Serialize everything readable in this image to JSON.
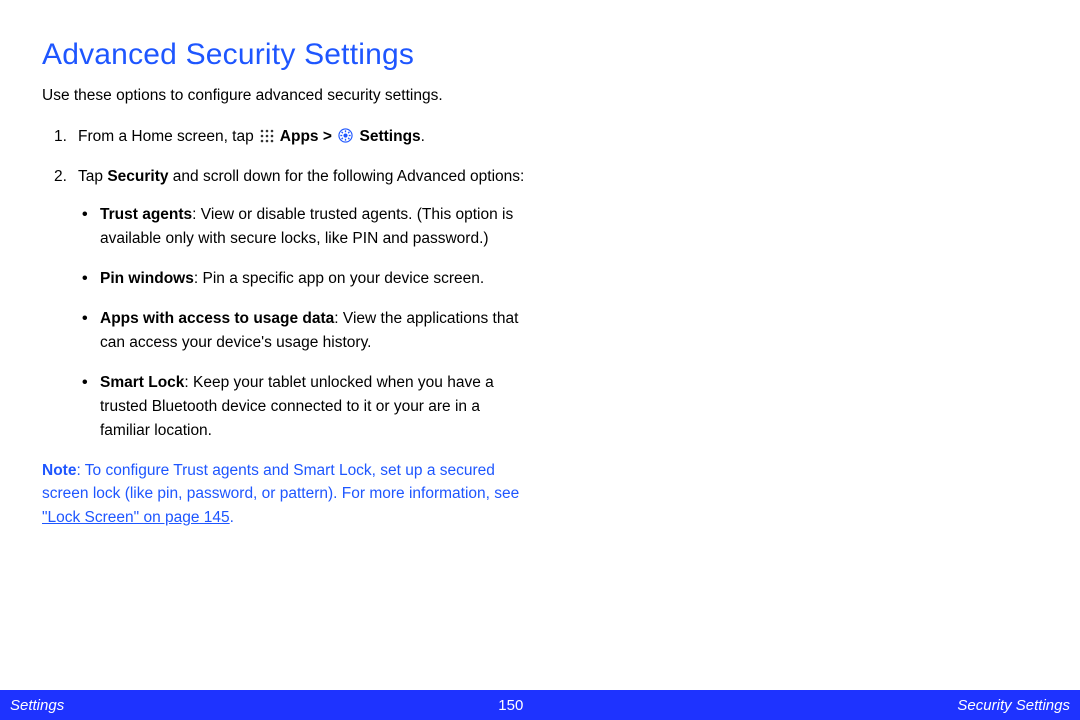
{
  "title": "Advanced Security Settings",
  "intro": "Use these options to configure advanced security settings.",
  "step1": {
    "num": "1.",
    "pre": "From a Home screen, tap ",
    "apps": " Apps > ",
    "settings": " Settings",
    "tail": "."
  },
  "step2": {
    "num": "2.",
    "lead_a": "Tap ",
    "lead_bold": "Security",
    "lead_b": " and scroll down for the following Advanced options:"
  },
  "bullets": {
    "b1_t": "Trust agents",
    "b1_r": ": View or disable trusted agents. (This option is available only with secure locks, like PIN and password.)",
    "b2_t": "Pin windows",
    "b2_r": ": Pin a specific app on your device screen.",
    "b3_t": "Apps with access to usage data",
    "b3_r": ": View the applications that can access your device's usage history.",
    "b4_t": "Smart Lock",
    "b4_r": ": Keep your tablet unlocked when you have a trusted Bluetooth device connected to it or your are in a familiar location."
  },
  "note": {
    "label": "Note",
    "body": ": To configure Trust agents and Smart Lock, set up a secured screen lock (like pin, password, or pattern). For more information, see ",
    "link": "\"Lock Screen\" on page 145",
    "tail": "."
  },
  "footer": {
    "left": "Settings",
    "center": "150",
    "right": "Security Settings"
  }
}
